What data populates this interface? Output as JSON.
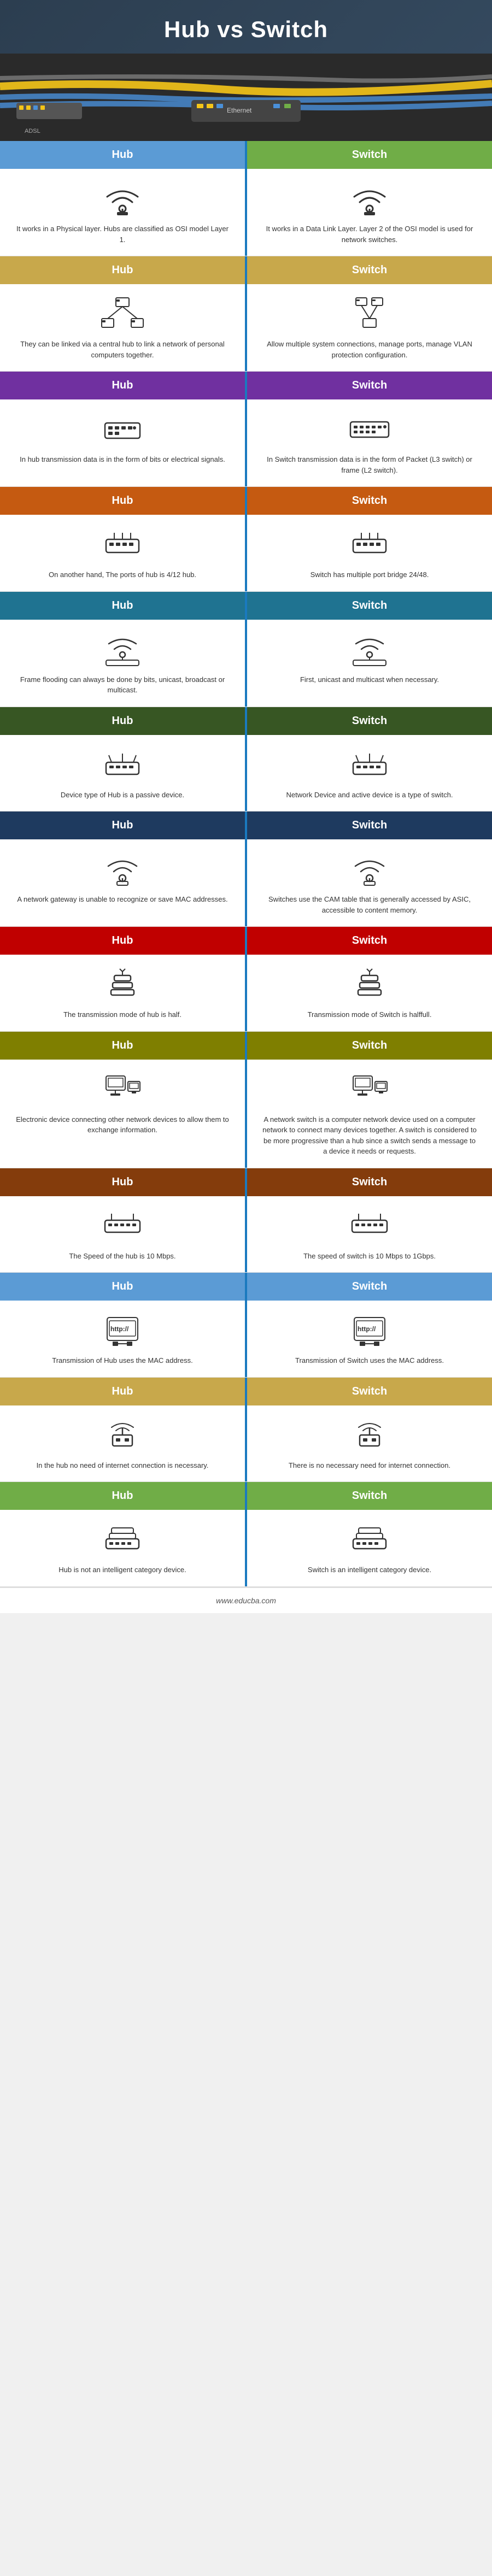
{
  "title": "Hub vs Switch",
  "footer": "www.educba.com",
  "header_subtitle": "",
  "sections": [
    {
      "hub_label": "Hub",
      "switch_label": "Switch",
      "hub_text": "It works in a Physical layer. Hubs are classified as OSI model Layer 1.",
      "switch_text": "It works in a Data Link Layer. Layer 2 of the OSI model is used for network switches.",
      "hub_color": "#5b9bd5",
      "switch_color": "#70ad47",
      "hub_icon": "wifi",
      "switch_icon": "wifi"
    },
    {
      "hub_label": "Hub",
      "switch_label": "Switch",
      "hub_text": "They can be linked via a central hub to link a network of personal computers together.",
      "switch_text": "Allow multiple system connections, manage ports, manage VLAN protection configuration.",
      "hub_color": "#c8a84b",
      "switch_color": "#c8a84b",
      "hub_icon": "network",
      "switch_icon": "multinetwork"
    },
    {
      "hub_label": "Hub",
      "switch_label": "Switch",
      "hub_text": "In hub transmission data is in the form of bits or electrical signals.",
      "switch_text": "In Switch transmission data is in the form of Packet (L3 switch) or frame (L2 switch).",
      "hub_color": "#7030a0",
      "switch_color": "#7030a0",
      "hub_icon": "hub",
      "switch_icon": "switch"
    },
    {
      "hub_label": "Hub",
      "switch_label": "Switch",
      "hub_text": "On another hand, The ports of hub is 4/12 hub.",
      "switch_text": "Switch has multiple port bridge 24/48.",
      "hub_color": "#c55a11",
      "switch_color": "#c55a11",
      "hub_icon": "router",
      "switch_icon": "router"
    },
    {
      "hub_label": "Hub",
      "switch_label": "Switch",
      "hub_text": "Frame flooding can always be done by bits, unicast, broadcast or multicast.",
      "switch_text": "First, unicast and multicast when necessary.",
      "hub_color": "#1f7391",
      "switch_color": "#1f7391",
      "hub_icon": "router2",
      "switch_icon": "router2"
    },
    {
      "hub_label": "Hub",
      "switch_label": "Switch",
      "hub_text": "Device type of Hub is a passive device.",
      "switch_text": "Network Device and active device is a type of switch.",
      "hub_color": "#375623",
      "switch_color": "#375623",
      "hub_icon": "router3",
      "switch_icon": "router3"
    },
    {
      "hub_label": "Hub",
      "switch_label": "Switch",
      "hub_text": "A network gateway is unable to recognize or save MAC addresses.",
      "switch_text": "Switches use the CAM table that is generally accessed by ASIC, accessible to content memory.",
      "hub_color": "#1e3a5f",
      "switch_color": "#1e3a5f",
      "hub_icon": "wifi2",
      "switch_icon": "wifi2"
    },
    {
      "hub_label": "Hub",
      "switch_label": "Switch",
      "hub_text": "The transmission mode of hub is half.",
      "switch_text": "Transmission mode of Switch is halffull.",
      "hub_color": "#c00000",
      "switch_color": "#c00000",
      "hub_icon": "tower",
      "switch_icon": "tower"
    },
    {
      "hub_label": "Hub",
      "switch_label": "Switch",
      "hub_text": "Electronic device connecting other network devices to allow them to exchange information.",
      "switch_text": "A network switch is a computer network device used on a computer network to connect many devices together. A switch is considered to be more progressive than a hub since a switch sends a message to a device it needs or requests.",
      "hub_color": "#7f7f00",
      "switch_color": "#7f7f00",
      "hub_icon": "pc",
      "switch_icon": "pc"
    },
    {
      "hub_label": "Hub",
      "switch_label": "Switch",
      "hub_text": "The Speed of the hub is 10 Mbps.",
      "switch_text": "The speed of switch is 10 Mbps to 1Gbps.",
      "hub_color": "#843c0c",
      "switch_color": "#843c0c",
      "hub_icon": "router4",
      "switch_icon": "router4"
    },
    {
      "hub_label": "Hub",
      "switch_label": "Switch",
      "hub_text": "Transmission of Hub uses the MAC address.",
      "switch_text": "Transmission of Switch uses the MAC address.",
      "hub_color": "#5b9bd5",
      "switch_color": "#5b9bd5",
      "hub_icon": "http",
      "switch_icon": "http"
    },
    {
      "hub_label": "Hub",
      "switch_label": "Switch",
      "hub_text": "In the hub no need of internet connection is necessary.",
      "switch_text": "There is no necessary need for internet connection.",
      "hub_color": "#c8a84b",
      "switch_color": "#c8a84b",
      "hub_icon": "tower2",
      "switch_icon": "tower2"
    },
    {
      "hub_label": "Hub",
      "switch_label": "Switch",
      "hub_text": "Hub is not an intelligent category device.",
      "switch_text": "Switch is an intelligent category device.",
      "hub_color": "#70ad47",
      "switch_color": "#70ad47",
      "hub_icon": "router5",
      "switch_icon": "router5"
    }
  ]
}
